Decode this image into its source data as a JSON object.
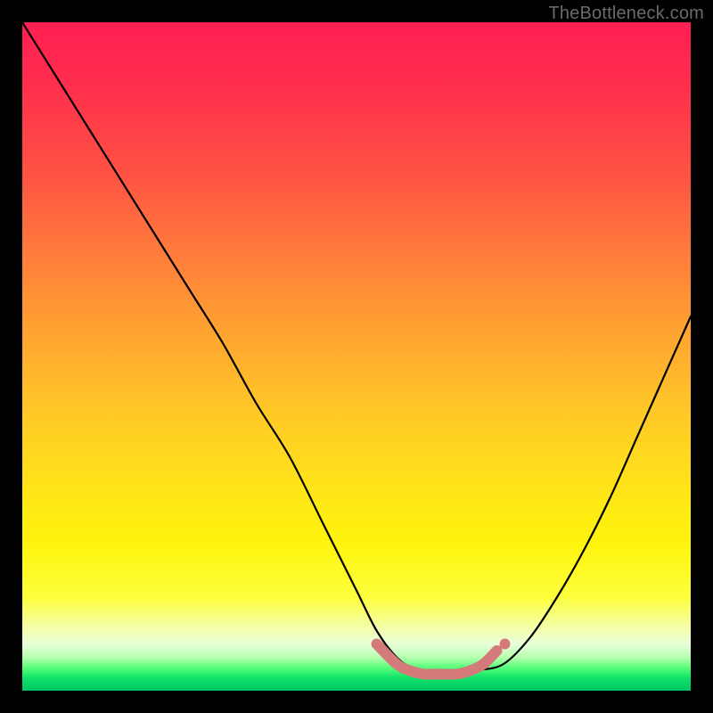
{
  "watermark": "TheBottleneck.com",
  "chart_data": {
    "type": "line",
    "title": "",
    "xlabel": "",
    "ylabel": "",
    "xlim": [
      0,
      100
    ],
    "ylim": [
      0,
      100
    ],
    "curve_description": "V-shaped bottleneck curve on rainbow gradient background; y is bottleneck severity (0 = green/good, 100 = red/bad). Values estimated from plot pixels.",
    "series": [
      {
        "name": "bottleneck_curve",
        "x": [
          0,
          5,
          10,
          15,
          20,
          25,
          30,
          35,
          40,
          45,
          50,
          53,
          56,
          59,
          62,
          65,
          68,
          72,
          76,
          80,
          84,
          88,
          92,
          96,
          100
        ],
        "y": [
          100,
          92,
          84,
          76,
          68,
          60,
          52,
          43,
          35,
          25,
          15,
          9,
          5,
          3,
          2,
          2,
          3,
          4,
          8,
          14,
          21,
          29,
          38,
          47,
          56
        ]
      }
    ],
    "optimal_band": {
      "name": "sweet_spot_marker",
      "color": "#d47a7a",
      "x": [
        53,
        56,
        58,
        60,
        62,
        65,
        67,
        69,
        71
      ],
      "y": [
        7,
        4,
        3,
        2.5,
        2.5,
        2.5,
        3,
        4,
        6
      ]
    },
    "gradient_stops": [
      {
        "pos": 0.0,
        "color": "#ff1f52"
      },
      {
        "pos": 0.46,
        "color": "#ffa231"
      },
      {
        "pos": 0.78,
        "color": "#fff40d"
      },
      {
        "pos": 0.95,
        "color": "#b7ffb0"
      },
      {
        "pos": 1.0,
        "color": "#00c464"
      }
    ]
  }
}
